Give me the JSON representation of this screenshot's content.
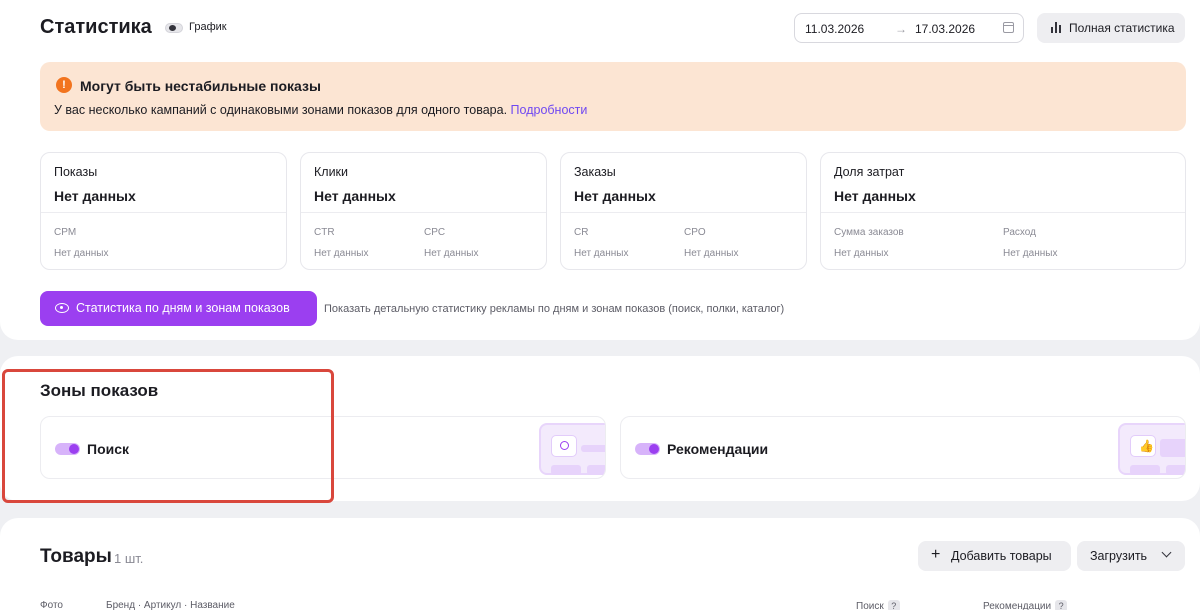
{
  "stats": {
    "title": "Статистика",
    "graph_toggle_label": "График",
    "date_from": "11.03.2026",
    "date_arrow": "→",
    "date_to": "17.03.2026",
    "full_stats_label": "Полная статистика"
  },
  "alert": {
    "title": "Могут быть нестабильные показы",
    "text": "У вас несколько кампаний с одинаковыми зонами показов для одного товара. ",
    "link": "Подробности",
    "icon_glyph": "!",
    "color": "#f2741f"
  },
  "metrics": [
    {
      "label": "Показы",
      "value": "Нет данных",
      "subs": [
        {
          "label": "CPM",
          "value": "Нет данных"
        }
      ]
    },
    {
      "label": "Клики",
      "value": "Нет данных",
      "subs": [
        {
          "label": "CTR",
          "value": "Нет данных"
        },
        {
          "label": "CPC",
          "value": "Нет данных"
        }
      ]
    },
    {
      "label": "Заказы",
      "value": "Нет данных",
      "subs": [
        {
          "label": "CR",
          "value": "Нет данных"
        },
        {
          "label": "CPO",
          "value": "Нет данных"
        }
      ]
    },
    {
      "label": "Доля затрат",
      "value": "Нет данных",
      "subs": [
        {
          "label": "Сумма заказов",
          "value": "Нет данных"
        },
        {
          "label": "Расход",
          "value": "Нет данных"
        }
      ]
    }
  ],
  "daily_button": {
    "label": "Статистика по дням и зонам показов",
    "hint": "Показать детальную статистику рекламы по дням и зонам показов (поиск, полки, каталог)"
  },
  "zones": {
    "title": "Зоны показов",
    "search_label": "Поиск",
    "reco_label": "Рекомендации",
    "search_enabled": true,
    "reco_enabled": true
  },
  "goods": {
    "title": "Товары",
    "count": "1 шт.",
    "add_label": "Добавить товары",
    "load_label": "Загрузить",
    "columns": {
      "photo": "Фото",
      "brand": "Бренд · Артикул · Название",
      "search": "Поиск",
      "reco": "Рекомендации"
    },
    "help_glyph": "?"
  },
  "colors": {
    "accent": "#9b3ff0",
    "alert_bg": "#fce5d3",
    "highlight_frame": "#d9473c",
    "link": "#6f48f2"
  }
}
